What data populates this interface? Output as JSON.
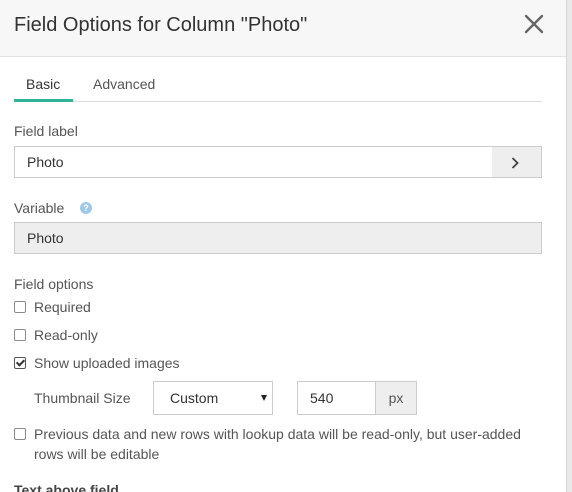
{
  "dialog": {
    "title": "Field Options for Column \"Photo\"",
    "close_icon": "close-icon"
  },
  "tabs": [
    {
      "label": "Basic",
      "active": true
    },
    {
      "label": "Advanced",
      "active": false
    }
  ],
  "field_label": {
    "label": "Field label",
    "value": "Photo",
    "action_icon": "chevron-right-icon"
  },
  "variable": {
    "label": "Variable",
    "value": "Photo",
    "help_icon": "question-circle-icon"
  },
  "field_options": {
    "label": "Field options",
    "options": [
      {
        "label": "Required",
        "checked": false
      },
      {
        "label": "Read-only",
        "checked": false
      },
      {
        "label": "Show uploaded images",
        "checked": true
      },
      {
        "label": "Previous data and new rows with lookup data will be read-only, but user-added rows will be editable",
        "checked": false
      }
    ],
    "thumbnail": {
      "label": "Thumbnail Size",
      "selected": "Custom",
      "value": "540",
      "unit": "px"
    }
  },
  "next_section_label": "Text above field",
  "colors": {
    "accent": "#2eb398",
    "header_bg": "#f7f7f7",
    "readonly_bg": "#eeeeee"
  }
}
